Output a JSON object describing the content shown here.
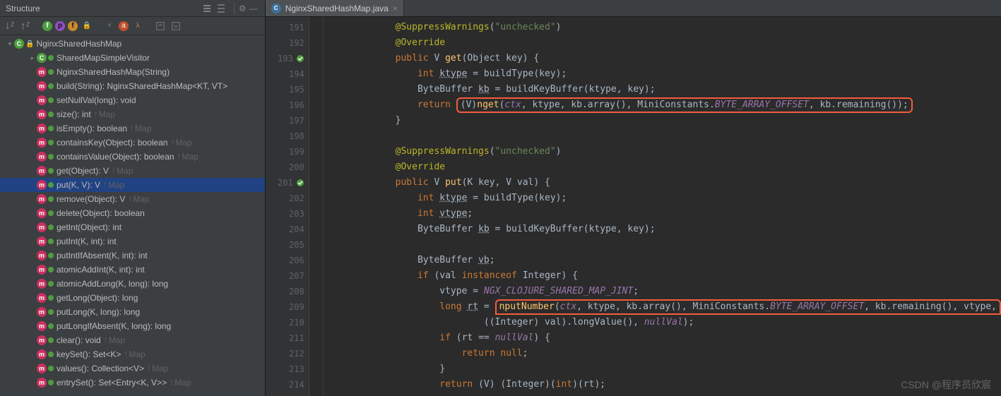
{
  "panel": {
    "title": "Structure"
  },
  "tab": {
    "label": "NginxSharedHashMap.java"
  },
  "tree": {
    "root": "NginxSharedHashMap",
    "nodes": [
      {
        "icon": "c",
        "arrow": true,
        "depth": 1,
        "label": "SharedMapSimpleVisitor"
      },
      {
        "icon": "m",
        "depth": 1,
        "label": "NginxSharedHashMap(String)"
      },
      {
        "icon": "m",
        "depth": 1,
        "label": "build(String): NginxSharedHashMap<KT, VT>"
      },
      {
        "icon": "m",
        "depth": 1,
        "label": "setNullVal(long): void"
      },
      {
        "icon": "m",
        "depth": 1,
        "label": "size(): int",
        "sup": "Map"
      },
      {
        "icon": "m",
        "depth": 1,
        "label": "isEmpty(): boolean",
        "sup": "Map"
      },
      {
        "icon": "m",
        "depth": 1,
        "label": "containsKey(Object): boolean",
        "sup": "Map"
      },
      {
        "icon": "m",
        "depth": 1,
        "label": "containsValue(Object): boolean",
        "sup": "Map"
      },
      {
        "icon": "m",
        "depth": 1,
        "label": "get(Object): V",
        "sup": "Map"
      },
      {
        "icon": "m",
        "depth": 1,
        "label": "put(K, V): V",
        "sup": "Map",
        "sel": true
      },
      {
        "icon": "m",
        "depth": 1,
        "label": "remove(Object): V",
        "sup": "Map"
      },
      {
        "icon": "m",
        "depth": 1,
        "label": "delete(Object): boolean"
      },
      {
        "icon": "m",
        "depth": 1,
        "label": "getInt(Object): int"
      },
      {
        "icon": "m",
        "depth": 1,
        "label": "putInt(K, int): int"
      },
      {
        "icon": "m",
        "depth": 1,
        "label": "putIntIfAbsent(K, int): int"
      },
      {
        "icon": "m",
        "depth": 1,
        "label": "atomicAddInt(K, int): int"
      },
      {
        "icon": "m",
        "depth": 1,
        "label": "atomicAddLong(K, long): long"
      },
      {
        "icon": "m",
        "depth": 1,
        "label": "getLong(Object): long"
      },
      {
        "icon": "m",
        "depth": 1,
        "label": "putLong(K, long): long"
      },
      {
        "icon": "m",
        "depth": 1,
        "label": "putLongIfAbsent(K, long): long"
      },
      {
        "icon": "m",
        "depth": 1,
        "label": "clear(): void",
        "sup": "Map"
      },
      {
        "icon": "m",
        "depth": 1,
        "label": "keySet(): Set<K>",
        "sup": "Map"
      },
      {
        "icon": "m",
        "depth": 1,
        "label": "values(): Collection<V>",
        "sup": "Map"
      },
      {
        "icon": "m",
        "depth": 1,
        "label": "entrySet(): Set<Entry<K, V>>",
        "sup": "Map"
      }
    ]
  },
  "code": {
    "lines": [
      {
        "n": 191,
        "html": "            <span class='an'>@SuppressWarnings</span>(<span class='st'>\"unchecked\"</span>)"
      },
      {
        "n": 192,
        "html": "            <span class='an'>@Override</span>"
      },
      {
        "n": 193,
        "mk": "o",
        "html": "            <span class='kw'>public</span> <span class='ty'>V</span> <span class='fn'>get</span>(Object key) {"
      },
      {
        "n": 194,
        "html": "                <span class='kw'>int</span> <span class='und'>ktype</span> = buildType(key);"
      },
      {
        "n": 195,
        "html": "                ByteBuffer <span class='und'>kb</span> = buildKeyBuffer(ktype, key);"
      },
      {
        "n": 196,
        "html": "                <span class='kw'>return</span> <span class='box'>(<span class='ty'>V</span>)<span class='fn'>nget</span>(<span class='fd'>ctx</span>, ktype, kb.array(), MiniConstants.<span class='fd'>BYTE_ARRAY_OFFSET</span>, kb.remaining());</span>"
      },
      {
        "n": 197,
        "html": "            }"
      },
      {
        "n": 198,
        "html": ""
      },
      {
        "n": 199,
        "html": "            <span class='an'>@SuppressWarnings</span>(<span class='st'>\"unchecked\"</span>)"
      },
      {
        "n": 200,
        "html": "            <span class='an'>@Override</span>"
      },
      {
        "n": 201,
        "mk": "o",
        "html": "            <span class='kw'>public</span> <span class='ty'>V</span> <span class='fn'>put</span>(<span class='ty'>K</span> key, <span class='ty'>V</span> val) {"
      },
      {
        "n": 202,
        "html": "                <span class='kw'>int</span> <span class='und'>ktype</span> = buildType(key);"
      },
      {
        "n": 203,
        "html": "                <span class='kw'>int</span> <span class='und'>vtype</span>;"
      },
      {
        "n": 204,
        "html": "                ByteBuffer <span class='und'>kb</span> = buildKeyBuffer(ktype, key);"
      },
      {
        "n": 205,
        "html": ""
      },
      {
        "n": 206,
        "html": "                ByteBuffer <span class='und'>vb</span>;"
      },
      {
        "n": 207,
        "html": "                <span class='kw'>if</span> (val <span class='kw'>instanceof</span> Integer) {"
      },
      {
        "n": 208,
        "html": "                    vtype = <span class='fd'>NGX_CLOJURE_SHARED_MAP_JINT</span>;"
      },
      {
        "n": 209,
        "html": "                    <span class='kw'>long</span> <span class='und'>rt</span> = <span class='box' style='border-bottom-left-radius:0;border-bottom-right-radius:0'><span class='fn'>nputNumber</span>(<span class='fd'>ctx</span>, ktype, kb.array(), MiniConstants.<span class='fd'>BYTE_ARRAY_OFFSET</span>, kb.remaining(), vtype,</span>"
      },
      {
        "n": 210,
        "html": "                            ((Integer) val).longValue(), <span class='fd'>nullVal</span>);"
      },
      {
        "n": 211,
        "html": "                    <span class='kw'>if</span> (rt == <span class='fd'>nullVal</span>) {"
      },
      {
        "n": 212,
        "html": "                        <span class='kw'>return null</span>;"
      },
      {
        "n": 213,
        "html": "                    }"
      },
      {
        "n": 214,
        "html": "                    <span class='kw'>return</span> (<span class='ty'>V</span>) (Integer)(<span class='kw'>int</span>)(rt);"
      }
    ]
  },
  "watermark": "CSDN @程序员欣宸"
}
